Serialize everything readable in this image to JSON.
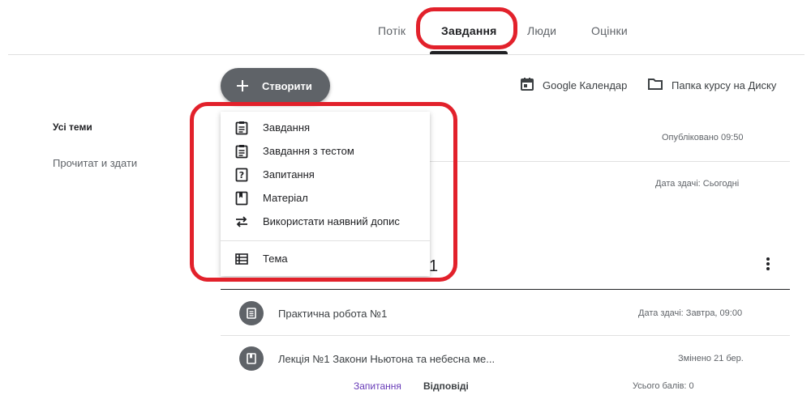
{
  "nav": {
    "tabs": [
      {
        "label": "Потік"
      },
      {
        "label": "Завдання"
      },
      {
        "label": "Люди"
      },
      {
        "label": "Оцінки"
      }
    ]
  },
  "sidebar": {
    "items": [
      {
        "label": "Усі теми"
      },
      {
        "label": "Прочитат и здати"
      }
    ]
  },
  "toolbar": {
    "create_label": "Створити",
    "calendar_label": "Google Календар",
    "drive_label": "Папка курсу на Диску"
  },
  "create_menu": {
    "items": [
      {
        "label": "Завдання",
        "icon": "assignment-icon"
      },
      {
        "label": "Завдання з тестом",
        "icon": "quiz-assignment-icon"
      },
      {
        "label": "Запитання",
        "icon": "question-icon"
      },
      {
        "label": "Матеріал",
        "icon": "material-icon"
      },
      {
        "label": "Використати наявний допис",
        "icon": "reuse-post-icon"
      }
    ],
    "topic_item": {
      "label": "Тема",
      "icon": "topic-icon"
    }
  },
  "stream": {
    "meta_published": "Опубліковано 09:50",
    "meta_due_today": "Дата здачі: Сьогодні",
    "topic_partial": "1",
    "rows": [
      {
        "title": "Практична робота №1",
        "meta": "Дата здачі: Завтра, 09:00"
      },
      {
        "title": "Лекція №1 Закони Ньютона та небесна ме...",
        "meta": "Змінено 21 бер."
      }
    ],
    "subtabs": {
      "questions": "Запитання",
      "answers": "Відповіді"
    },
    "total_points": "Усього балів: 0"
  },
  "colors": {
    "highlight": "#e2212b",
    "accent_purple": "#673ab7",
    "button_grey": "#5f6368"
  }
}
